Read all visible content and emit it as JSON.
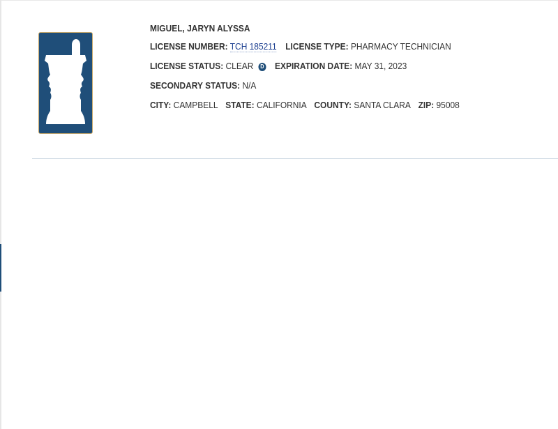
{
  "licensee": {
    "name": "MIGUEL, JARYN ALYSSA",
    "license_number_label": "LICENSE NUMBER:",
    "license_number": "TCH 185211",
    "license_type_label": "LICENSE TYPE:",
    "license_type": "PHARMACY TECHNICIAN",
    "license_status_label": "LICENSE STATUS:",
    "license_status": "CLEAR",
    "status_icon_glyph": "D",
    "expiration_date_label": "EXPIRATION DATE:",
    "expiration_date": "MAY 31, 2023",
    "secondary_status_label": "SECONDARY STATUS:",
    "secondary_status": "N/A",
    "city_label": "CITY:",
    "city": "CAMPBELL",
    "state_label": "STATE:",
    "state": "CALIFORNIA",
    "county_label": "COUNTY:",
    "county": "SANTA CLARA",
    "zip_label": "ZIP:",
    "zip": "95008"
  },
  "logo": {
    "icon": "mortar-and-pestle-icon",
    "background_color": "#1f4e79",
    "border_color": "#c8a96b"
  },
  "colors": {
    "link": "#1a3d8f",
    "divider": "#c9d5e1",
    "text": "#333333"
  }
}
